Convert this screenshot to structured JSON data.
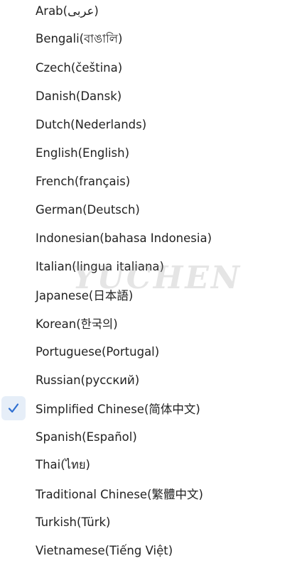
{
  "languages": [
    {
      "label": "Arab(عربى)",
      "selected": false
    },
    {
      "label": "Bengali(বাঙালি)",
      "selected": false
    },
    {
      "label": "Czech(čeština)",
      "selected": false
    },
    {
      "label": "Danish(Dansk)",
      "selected": false
    },
    {
      "label": "Dutch(Nederlands)",
      "selected": false
    },
    {
      "label": "English(English)",
      "selected": false
    },
    {
      "label": "French(français)",
      "selected": false
    },
    {
      "label": "German(Deutsch)",
      "selected": false
    },
    {
      "label": "Indonesian(bahasa Indonesia)",
      "selected": false
    },
    {
      "label": "Italian(lingua italiana)",
      "selected": false
    },
    {
      "label": "Japanese(日本語)",
      "selected": false
    },
    {
      "label": "Korean(한국의)",
      "selected": false
    },
    {
      "label": "Portuguese(Portugal)",
      "selected": false
    },
    {
      "label": "Russian(русский)",
      "selected": false
    },
    {
      "label": "Simplified Chinese(简体中文)",
      "selected": true
    },
    {
      "label": "Spanish(Español)",
      "selected": false
    },
    {
      "label": "Thai(ไทย)",
      "selected": false
    },
    {
      "label": "Traditional Chinese(繁體中文)",
      "selected": false
    },
    {
      "label": "Turkish(Türk)",
      "selected": false
    },
    {
      "label": "Vietnamese(Tiếng Việt)",
      "selected": false
    }
  ],
  "watermark": "YUCHEN",
  "colors": {
    "text": "#222222",
    "check_accent": "#2f6fd1",
    "check_bg": "#e6eef8"
  },
  "icons": {
    "selected": "checkmark-icon"
  }
}
